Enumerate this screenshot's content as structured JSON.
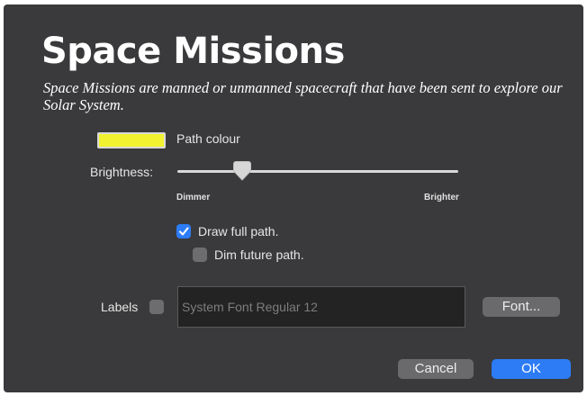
{
  "dialog": {
    "title": "Space Missions",
    "subtitle": "Space Missions are manned or unmanned spacecraft that have been sent to explore our Solar System."
  },
  "path_colour": {
    "label": "Path colour",
    "color": "#f2f230"
  },
  "brightness": {
    "label": "Brightness:",
    "min_label": "Dimmer",
    "max_label": "Brighter",
    "value": 0.23
  },
  "options": {
    "draw_full_path": {
      "label": "Draw full path.",
      "checked": true
    },
    "dim_future_path": {
      "label": "Dim future path.",
      "checked": false
    }
  },
  "labels": {
    "label": "Labels",
    "checked": false,
    "font_value": "System Font Regular 12",
    "font_button": "Font..."
  },
  "buttons": {
    "cancel": "Cancel",
    "ok": "OK"
  },
  "colors": {
    "dialog_background": "#3a3a3c",
    "accent": "#2d7cf6",
    "button_gray": "#6a6a6c"
  }
}
